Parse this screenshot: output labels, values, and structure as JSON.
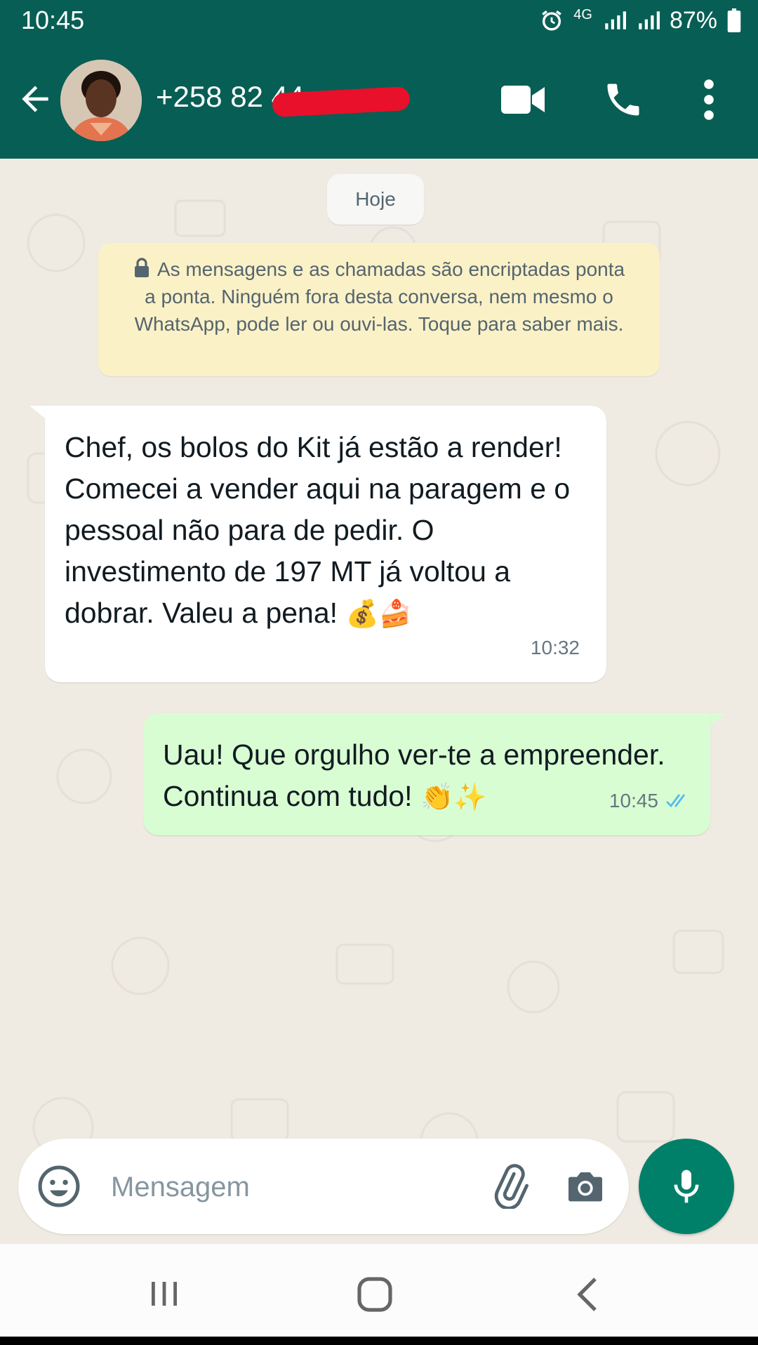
{
  "status_bar": {
    "time": "10:45",
    "network": "4G",
    "battery": "87%"
  },
  "header": {
    "contact": "+258 82 44",
    "colors": {
      "bar": "#075e54"
    }
  },
  "chat": {
    "date_chip": "Hoje",
    "encryption_notice": "As mensagens e as chamadas são encriptadas ponta a ponta. Ninguém fora desta conversa, nem mesmo o WhatsApp, pode ler ou ouvi-las. Toque para saber mais.",
    "messages": [
      {
        "direction": "incoming",
        "text": "Chef, os bolos do Kit já estão a render! Comecei a vender aqui na paragem e o pessoal não para de pedir. O investimento de 197 MT já voltou a dobrar. Valeu a pena!",
        "emojis": "💰🍰",
        "time": "10:32"
      },
      {
        "direction": "outgoing",
        "text": "Uau! Que orgulho ver-te a empreender. Continua com tudo!",
        "emojis": "👏✨",
        "time": "10:45",
        "status": "read-double-check-icon"
      }
    ]
  },
  "composer": {
    "placeholder": "Mensagem"
  },
  "colors": {
    "accent": "#008069",
    "incoming_bubble": "#ffffff",
    "outgoing_bubble": "#d9fdd3",
    "notice": "#fbf1c7"
  }
}
